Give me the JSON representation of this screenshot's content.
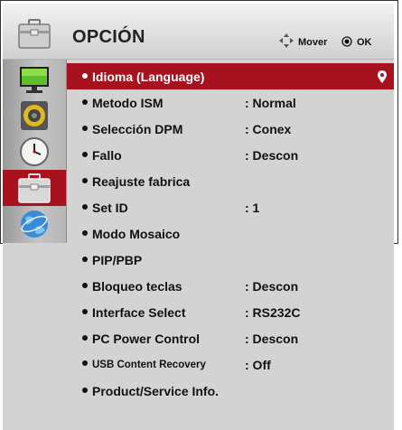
{
  "header": {
    "title": "OPCIÓN",
    "move_label": "Mover",
    "ok_label": "OK",
    "icon": "toolbox-icon"
  },
  "sidebar": {
    "items": [
      {
        "name": "picture",
        "icon": "monitor-icon"
      },
      {
        "name": "audio",
        "icon": "speaker-icon"
      },
      {
        "name": "time",
        "icon": "clock-icon"
      },
      {
        "name": "option",
        "icon": "toolbox-icon",
        "active": true
      },
      {
        "name": "network",
        "icon": "globe-icon"
      }
    ]
  },
  "menu": {
    "items": [
      {
        "label": "Idioma (Language)",
        "value": "",
        "selected": true
      },
      {
        "label": "Metodo ISM",
        "value": ": Normal"
      },
      {
        "label": "Selección DPM",
        "value": ": Conex"
      },
      {
        "label": "Fallo",
        "value": ": Descon"
      },
      {
        "label": "Reajuste fabrica",
        "value": ""
      },
      {
        "label": "Set ID",
        "value": ": 1"
      },
      {
        "label": "Modo Mosaico",
        "value": ""
      },
      {
        "label": "PIP/PBP",
        "value": ""
      },
      {
        "label": "Bloqueo teclas",
        "value": ": Descon"
      },
      {
        "label": "Interface Select",
        "value": ": RS232C"
      },
      {
        "label": "PC Power Control",
        "value": ": Descon"
      },
      {
        "label": "USB Content Recovery",
        "value": ": Off"
      },
      {
        "label": "Product/Service Info.",
        "value": ""
      }
    ]
  },
  "colors": {
    "selected": "#a8111e",
    "panel": "#d3d3d3"
  }
}
